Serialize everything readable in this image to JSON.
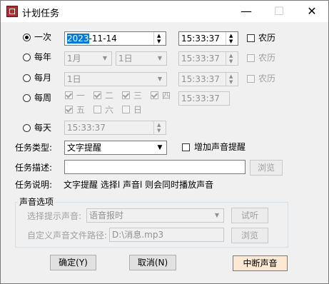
{
  "window": {
    "title": "计划任务",
    "minimize": "—",
    "maximize": "☐",
    "close": "✕"
  },
  "once": {
    "label": "一次",
    "date": "2023-11-14",
    "date_selected": "2023",
    "date_rest": "-11-14",
    "time": "15:33:37",
    "lunar_label": "农历"
  },
  "yearly": {
    "label": "每年",
    "month": "1月",
    "day": "1日",
    "time": "15:33:37",
    "lunar_label": "农历"
  },
  "monthly": {
    "label": "每月",
    "day": "1日",
    "time": "15:33:37",
    "lunar_label": "农历"
  },
  "weekly": {
    "label": "每周",
    "days": [
      "一",
      "二",
      "三",
      "四",
      "五",
      "六",
      "日"
    ],
    "time": "15:33:37"
  },
  "daily": {
    "label": "每天",
    "time": "15:33:37"
  },
  "task_type": {
    "label": "任务类型:",
    "value": "文字提醒"
  },
  "sound_reminder": {
    "label": "增加声音提醒"
  },
  "task_desc": {
    "label": "任务描述:",
    "value": "",
    "browse": "浏览"
  },
  "task_note": {
    "label": "任务说明:",
    "text": "文字提醒 选择l  声音l  则会同时播放声音"
  },
  "sound_options": {
    "title": "声音选项",
    "choose_label": "选择提示声音:",
    "choose_value": "语音报时",
    "listen": "试听",
    "custom_label": "自定义声音文件路径:",
    "custom_value": "D:\\消息.mp3",
    "browse": "浏览"
  },
  "buttons": {
    "ok": "确定(Y)",
    "cancel": "取消(N)",
    "stop_sound": "中断声音"
  }
}
